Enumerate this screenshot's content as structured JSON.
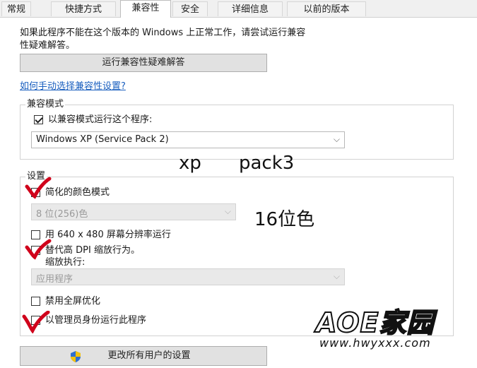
{
  "tabs": [
    {
      "label": "常规"
    },
    {
      "label": "快捷方式"
    },
    {
      "label": "兼容性"
    },
    {
      "label": "安全"
    },
    {
      "label": "详细信息"
    },
    {
      "label": "以前的版本"
    }
  ],
  "intro": {
    "line1": "如果此程序不能在这个版本的 Windows 上正常工作，请尝试运行兼容",
    "line2": "性疑难解答。"
  },
  "troubleshoot_button": "运行兼容性疑难解答",
  "manual_link": "如何手动选择兼容性设置?",
  "compat_mode": {
    "title": "兼容模式",
    "checkbox_label": "以兼容模式运行这个程序:",
    "checked": true,
    "selected_os": "Windows XP (Service Pack 2)"
  },
  "settings": {
    "title": "设置",
    "reduced_color": "简化的颜色模式",
    "color_depth": "8 位(256)色",
    "resolution_640": "用 640 x 480 屏幕分辨率运行",
    "dpi_override": "替代高 DPI 缩放行为。",
    "scaling_performed_by": "缩放执行:",
    "scaling_value": "应用程序",
    "disable_fullscreen_opt": "禁用全屏优化",
    "run_as_admin": "以管理员身份运行此程序"
  },
  "change_all_users_button": "更改所有用户的设置",
  "annotations": {
    "xp": "xp",
    "pack": "pack3",
    "color": "16位色"
  },
  "watermark": {
    "brand": "AOE家园",
    "url": "www.hwyxxx.com"
  },
  "colors": {
    "red_mark": "#d0021b",
    "link": "#1a5fbf"
  }
}
